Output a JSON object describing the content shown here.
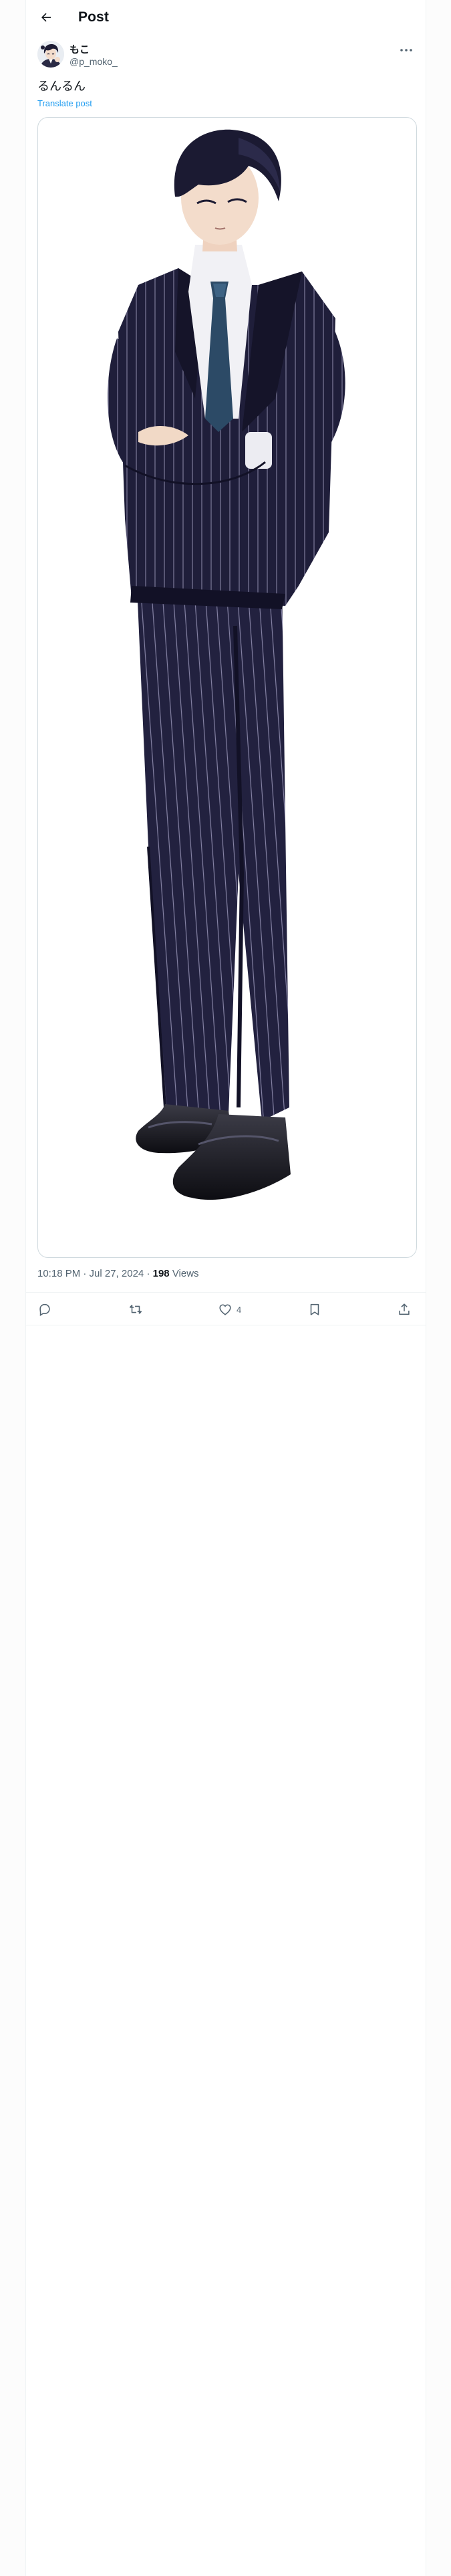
{
  "header": {
    "title": "Post",
    "back_icon": "arrow-left-icon"
  },
  "author": {
    "name": "もこ",
    "handle": "@p_moko_",
    "avatar_icon": "avatar-anime-character",
    "more_icon": "more-horizontal-icon"
  },
  "post": {
    "text": "るんるん",
    "translate_label": "Translate post",
    "media_description_icon": "illustration-man-in-pinstripe-suit"
  },
  "meta": {
    "timestamp": "10:18 PM · Jul 27, 2024",
    "separator": "·",
    "views_count": "198",
    "views_label": "Views"
  },
  "actions": {
    "reply_icon": "reply-icon",
    "repost_icon": "repost-icon",
    "like_icon": "heart-icon",
    "like_count": "4",
    "bookmark_icon": "bookmark-icon",
    "share_icon": "share-icon"
  },
  "colors": {
    "text_primary": "#0f1419",
    "text_secondary": "#536471",
    "link": "#1d9bf0",
    "border": "#eff3f4",
    "suit": "#1e1d3a",
    "pinstripe": "#8a88a8"
  }
}
